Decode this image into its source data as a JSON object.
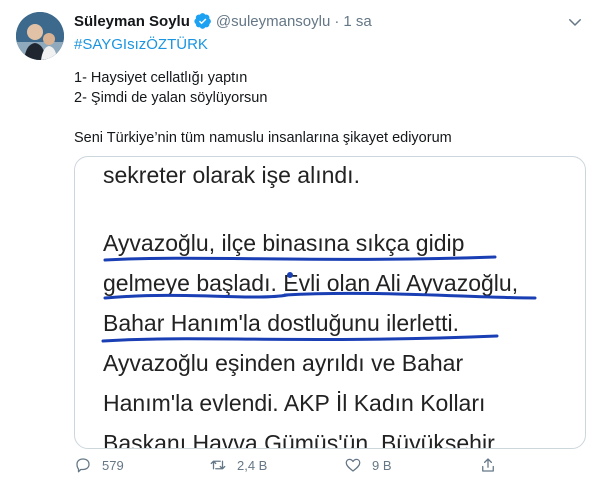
{
  "tweet": {
    "author_name": "Süleyman Soylu",
    "handle": "@suleymansoylu",
    "separator": "·",
    "time": "1 sa",
    "hashtag": "#SAYGIsızÖZTÜRK",
    "lines": [
      "1- Haysiyet cellatlığı yaptın",
      "2- Şimdi de yalan söylüyorsun",
      "Seni Türkiye’nin tüm namuslu insanlarına şikayet ediyorum"
    ]
  },
  "media": {
    "text_lines": [
      "sekreter olarak işe alındı.",
      "Ayvazoğlu, ilçe binasına sıkça gidip",
      "gelmeye başladı. Evli olan Ali Ayvazoğlu,",
      "Bahar Hanım'la dostluğunu ilerletti.",
      "Ayvazoğlu eşinden ayrıldı ve Bahar",
      "Hanım'la evlendi. AKP İl Kadın Kolları",
      "Başkanı Havva Gümüş'ün, Büyükşehir"
    ],
    "underline_color": "#1a3fb5"
  },
  "actions": {
    "reply_count": "579",
    "retweet_count": "2,4 B",
    "like_count": "9 B"
  },
  "colors": {
    "link": "#1b95e0",
    "muted": "#657786",
    "verified": "#1da1f2"
  }
}
